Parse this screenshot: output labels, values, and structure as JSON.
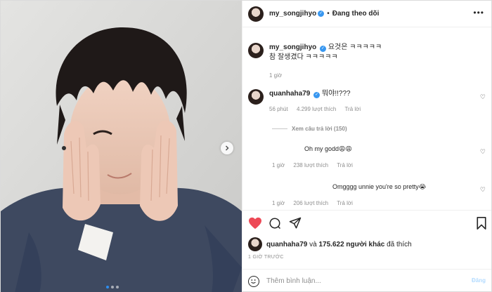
{
  "header": {
    "username": "my_songjihyo",
    "separator": "•",
    "follow_status": "Đang theo dõi",
    "verified_mark": "✓",
    "more_icon": "more-horizontal-icon"
  },
  "caption": {
    "username": "my_songjihyo",
    "verified_mark": "✓",
    "line1": "요것은 ㅋㅋㅋㅋㅋ",
    "line2": "참 잘생겼다 ㅋㅋㅋㅋㅋ",
    "time": "1 giờ"
  },
  "comments": [
    {
      "username": "quanhaha79",
      "verified_mark": "✓",
      "text": "뭐야!!???",
      "time": "56 phút",
      "likes": "4.299 lượt thích",
      "reply_label": "Trả lời",
      "view_replies": "Xem câu trả lời (150)"
    },
    {
      "text": "Oh my godd😩😩",
      "time": "1 giờ",
      "likes": "238 lượt thích",
      "reply_label": "Trả lời"
    },
    {
      "text": "Omgggg unnie you're so pretty😭",
      "time": "1 giờ",
      "likes": "206 lượt thích",
      "reply_label": "Trả lời"
    }
  ],
  "liked_by": {
    "user": "quanhaha79",
    "and": "và",
    "count": "175.622 người khác",
    "suffix": "đã thích"
  },
  "post_time": "1 GIỜ TRƯỚC",
  "add_comment": {
    "placeholder": "Thêm bình luận...",
    "post_label": "Đăng"
  },
  "colors": {
    "like_red": "#ed4956",
    "verified_blue": "#3897f0",
    "muted_text": "#8e8e8e",
    "post_button": "#b3dbff"
  },
  "carousel": {
    "total": 3,
    "active": 1
  }
}
